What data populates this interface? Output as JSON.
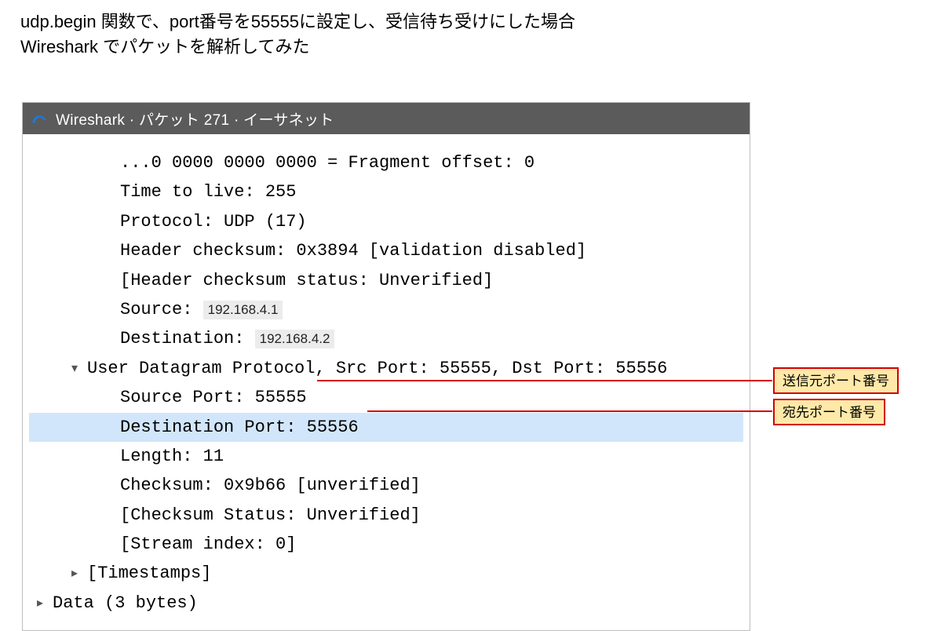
{
  "intro": {
    "line1": "udp.begin 関数で、port番号を55555に設定し、受信待ち受けにした場合",
    "line2": "Wireshark でパケットを解析してみた"
  },
  "window": {
    "title": "Wireshark · パケット 271 · イーサネット"
  },
  "packet": {
    "fragment_offset": "...0 0000 0000 0000 = Fragment offset: 0",
    "ttl": "Time to live: 255",
    "protocol": "Protocol: UDP (17)",
    "header_checksum": "Header checksum: 0x3894 [validation disabled]",
    "header_checksum_status": "[Header checksum status: Unverified]",
    "source_label": "Source: ",
    "source_ip": "192.168.4.1",
    "dest_label": "Destination: ",
    "dest_ip": "192.168.4.2",
    "udp_summary": "User Datagram Protocol, Src Port: 55555, Dst Port: 55556",
    "src_port": "Source Port: 55555",
    "dst_port": "Destination Port: 55556",
    "length": "Length: 11",
    "checksum": "Checksum: 0x9b66 [unverified]",
    "checksum_status": "[Checksum Status: Unverified]",
    "stream_index": "[Stream index: 0]",
    "timestamps": "[Timestamps]",
    "data": "Data (3 bytes)"
  },
  "callouts": {
    "src": "送信元ポート番号",
    "dst": "宛先ポート番号"
  }
}
